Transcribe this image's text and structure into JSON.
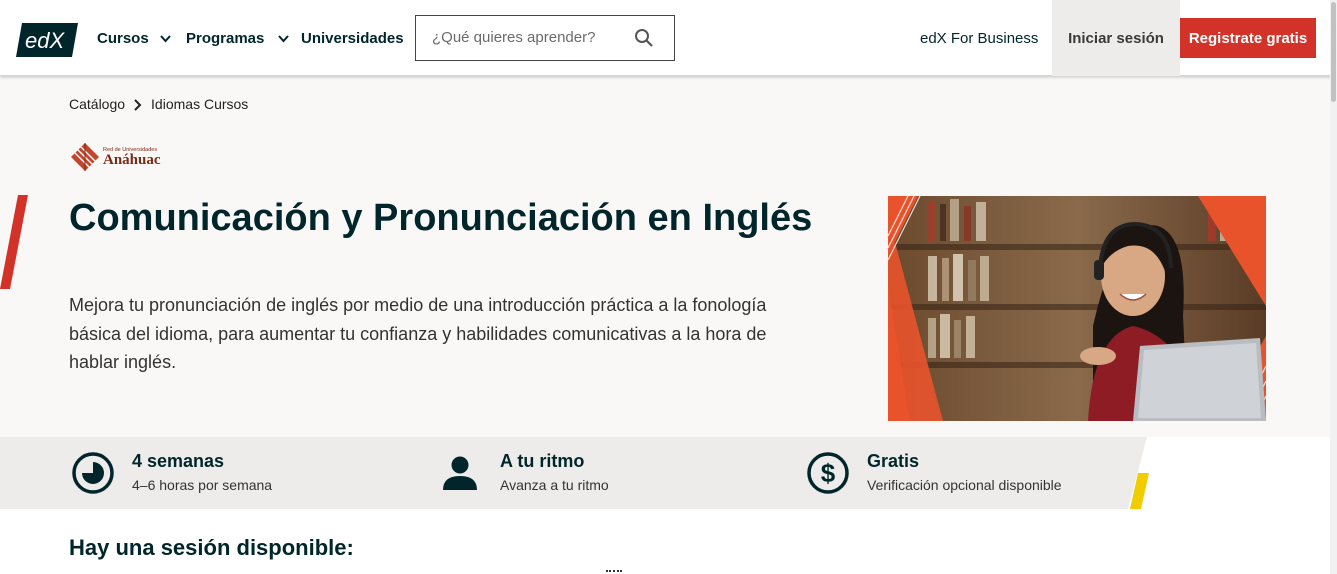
{
  "header": {
    "logo_text": "edX",
    "nav": [
      {
        "label": "Cursos",
        "has_dropdown": true,
        "icon": "chevron-down-icon"
      },
      {
        "label": "Programas",
        "has_dropdown": true,
        "icon": "chevron-down-icon"
      },
      {
        "label": "Universidades",
        "has_dropdown": false
      }
    ],
    "search": {
      "placeholder": "¿Qué quieres aprender?",
      "value": "",
      "icon": "search-icon"
    },
    "business_link": "edX For Business",
    "signin_label": "Iniciar sesión",
    "register_label": "Registrate gratis"
  },
  "breadcrumb": {
    "items": [
      "Catálogo",
      "Idiomas Cursos"
    ],
    "separator_icon": "chevron-right-icon"
  },
  "partner": {
    "small_text": "Red de Universidades",
    "name": "Anáhuac"
  },
  "course": {
    "title": "Comunicación y Pronunciación en Inglés",
    "description": "Mejora tu pronunciación de inglés por medio de una introducción práctica a la fonología básica del idioma, para aumentar tu confianza y habilidades comunicativas a la hora de hablar inglés."
  },
  "stats": [
    {
      "icon": "clock-icon",
      "label": "4 semanas",
      "sub": "4–6 horas por semana"
    },
    {
      "icon": "person-icon",
      "label": "A tu ritmo",
      "sub": "Avanza a tu ritmo"
    },
    {
      "icon": "dollar-icon",
      "label": "Gratis",
      "sub": "Verificación opcional disponible"
    }
  ],
  "session_heading": "Hay una sesión disponible:",
  "colors": {
    "brand_dark": "#00262b",
    "accent_red": "#d23228",
    "accent_yellow": "#f0cc00",
    "hero_bg": "#f9f8f7",
    "band_bg": "#eeecea"
  }
}
